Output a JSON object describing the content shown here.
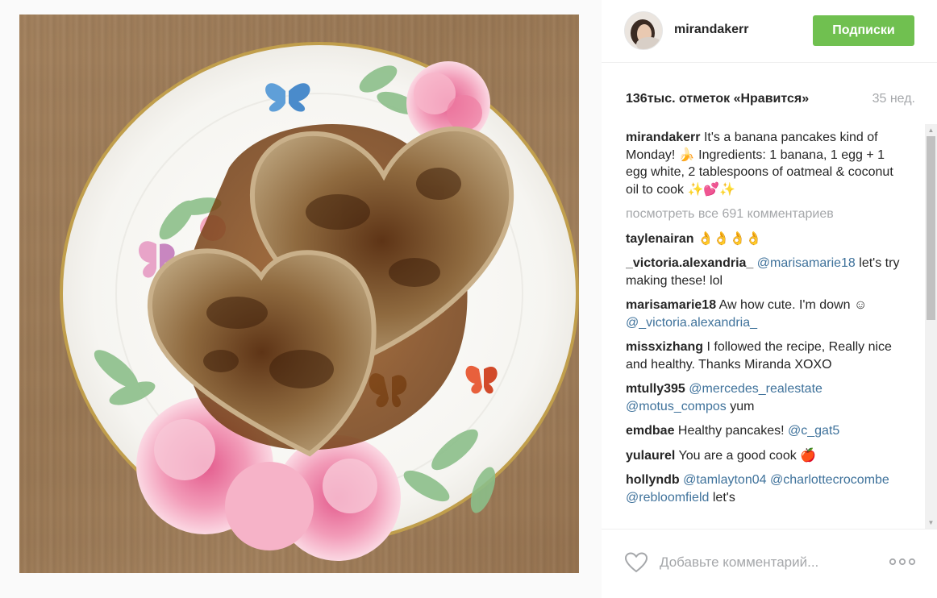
{
  "post": {
    "username": "mirandakerr",
    "follow_label": "Подписки",
    "likes": "136тыс. отметок «Нравится»",
    "age": "35 нед.",
    "caption": {
      "user": "mirandakerr",
      "text": "It's a banana pancakes kind of Monday! 🍌 Ingredients: 1 banana, 1 egg + 1 egg white, 2 tablespoons of oatmeal & coconut oil to cook ✨💕✨"
    },
    "view_all_comments": "посмотреть все 691 комментариев",
    "comments": [
      {
        "user": "taylenairan",
        "mention": "",
        "text": "👌👌👌👌"
      },
      {
        "user": "_victoria.alexandria_",
        "mention": "@marisamarie18",
        "text": "let's try making these! lol"
      },
      {
        "user": "marisamarie18",
        "mention": "",
        "text": "Aw how cute. I'm down ☺",
        "mention_after": "@_victoria.alexandria_"
      },
      {
        "user": "missxizhang",
        "mention": "",
        "text": "I followed the recipe, Really nice and healthy. Thanks Miranda XOXO"
      },
      {
        "user": "mtully395",
        "mention": "@mercedes_realestate @motus_compos",
        "text": "yum"
      },
      {
        "user": "emdbae",
        "mention": "",
        "text": "Healthy pancakes!",
        "mention_after": "@c_gat5"
      },
      {
        "user": "yulaurel",
        "mention": "",
        "text": "You are a good cook 🍎"
      },
      {
        "user": "hollyndb",
        "mention": "@tamlayton04 @charlottecrocombe @rebloomfield",
        "text": "let's"
      }
    ],
    "comment_placeholder": "Добавьте комментарий...",
    "more_label": "ooo"
  },
  "icons": {
    "avatar": "avatar",
    "heart": "heart-icon",
    "more": "more-options-icon"
  },
  "colors": {
    "follow_button": "#70c050",
    "mention": "#3f729b",
    "muted": "#a5a7aa"
  }
}
